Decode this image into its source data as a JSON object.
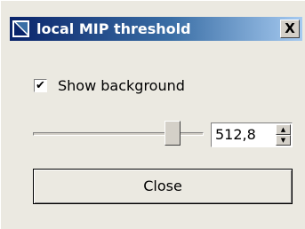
{
  "window": {
    "title": "local MIP threshold",
    "close_glyph": "X"
  },
  "options": {
    "show_background_label": "Show background",
    "show_background_checked": true,
    "check_glyph": "✔"
  },
  "threshold": {
    "slider_level": 0.82,
    "value": "512,8",
    "spin_up_glyph": "▲",
    "spin_down_glyph": "▼"
  },
  "actions": {
    "close_label": "Close"
  },
  "icons": {
    "title_icon": "window-app-icon"
  }
}
